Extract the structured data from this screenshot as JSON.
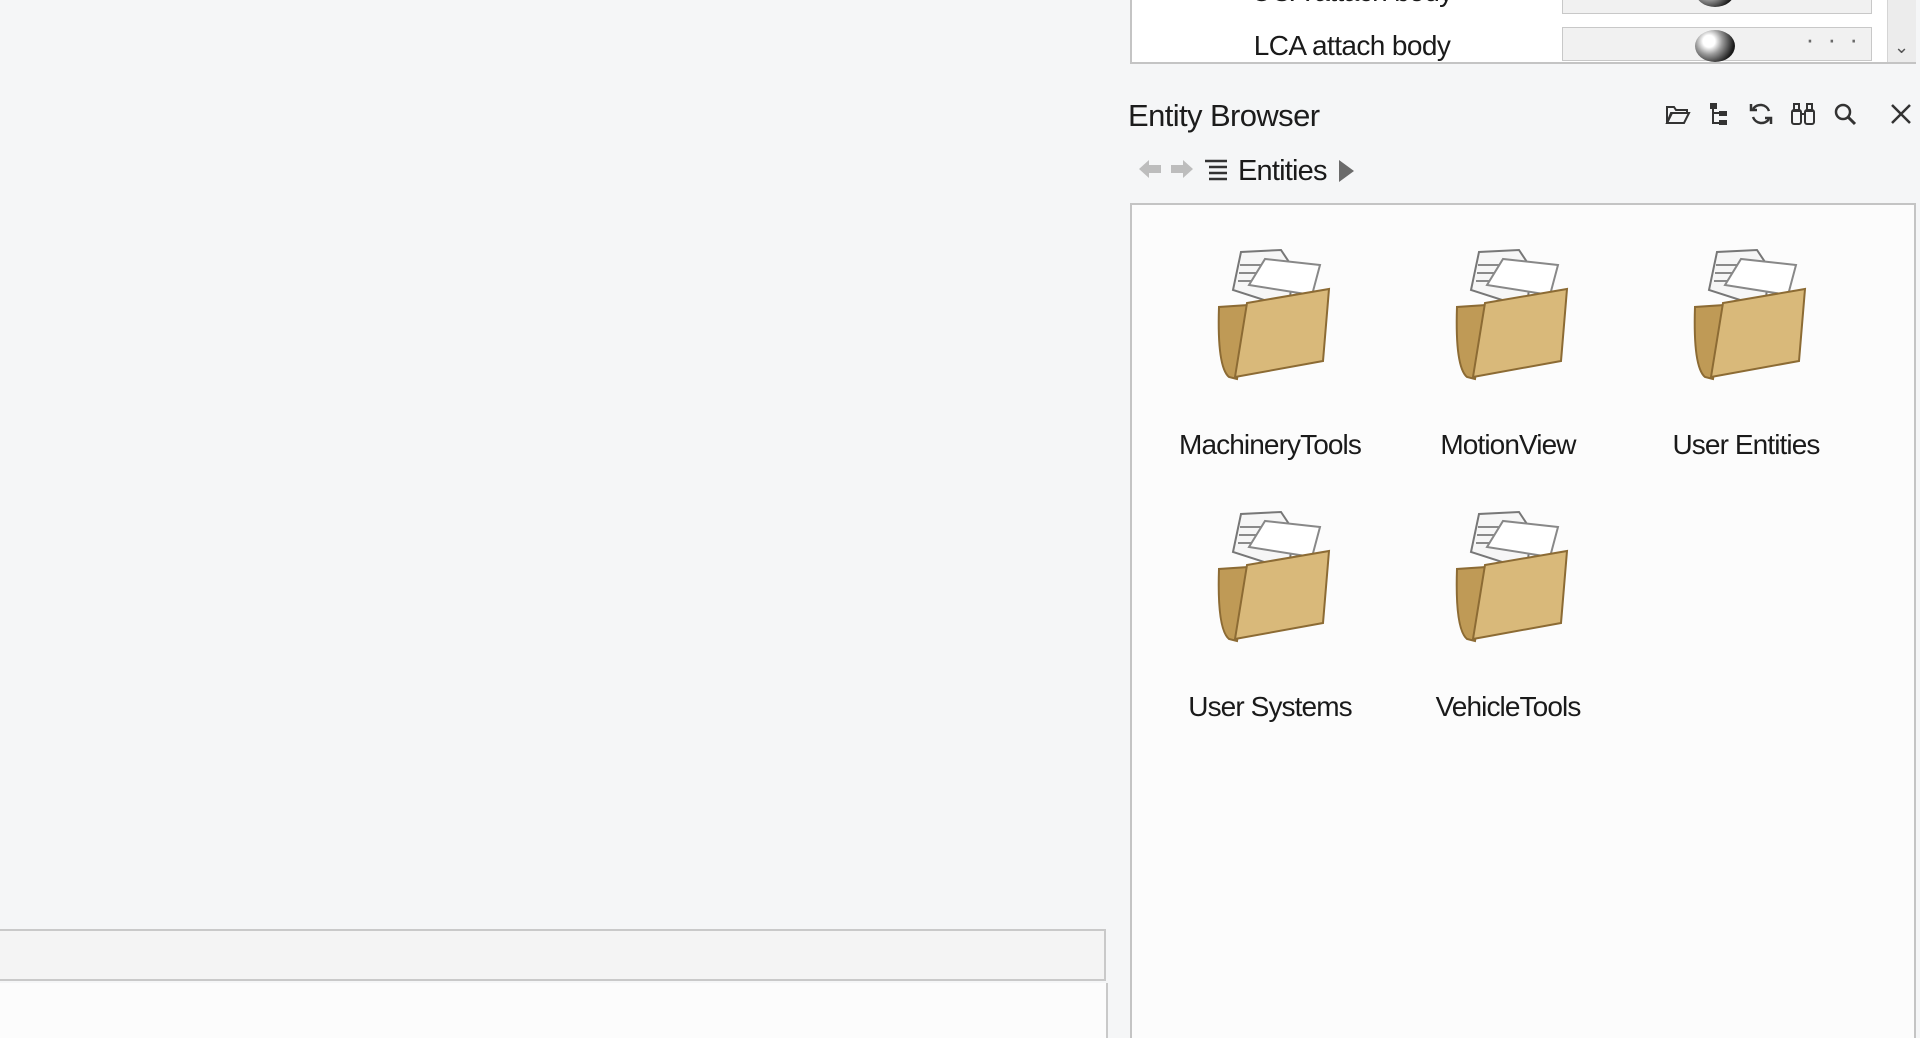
{
  "property_table": {
    "rows": [
      {
        "label": "UCA attach body"
      },
      {
        "label": "LCA attach body",
        "ellipsis": "· · ·"
      }
    ]
  },
  "entity_browser": {
    "title": "Entity Browser",
    "toolbar_icons": [
      "open-folder-icon",
      "tree-view-icon",
      "refresh-icon",
      "binoculars-icon",
      "search-icon",
      "close-icon"
    ],
    "breadcrumb": {
      "label": "Entities"
    },
    "folders": [
      {
        "label": "MachineryTools"
      },
      {
        "label": "MotionView"
      },
      {
        "label": "User Entities"
      },
      {
        "label": "User Systems"
      },
      {
        "label": "VehicleTools"
      }
    ]
  },
  "colors": {
    "folder_body": "#d9b97a",
    "background": "#f5f6f7",
    "content_bg": "#fcfcfc"
  }
}
